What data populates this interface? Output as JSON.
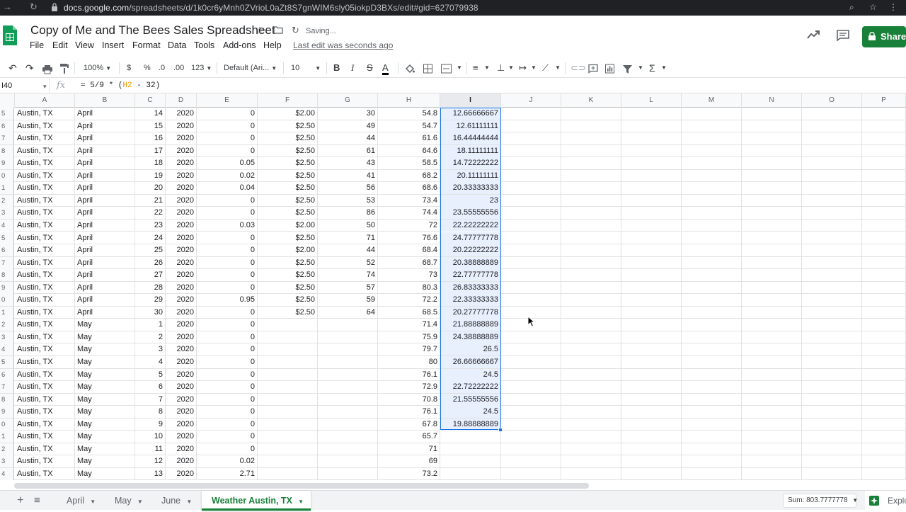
{
  "browser": {
    "url_host": "docs.google.com",
    "url_path": "/spreadsheets/d/1k0cr6yMnh0ZVrioL0aZt8S7gnWIM6sly05iokpD3BXs/edit#gid=627079938"
  },
  "header": {
    "title": "Copy of Me and The Bees Sales Spreadsheet",
    "saving_status": "Saving...",
    "menu": [
      "File",
      "Edit",
      "View",
      "Insert",
      "Format",
      "Data",
      "Tools",
      "Add-ons",
      "Help"
    ],
    "last_edit": "Last edit was seconds ago",
    "share_label": "Share"
  },
  "toolbar": {
    "zoom": "100%",
    "currency": "$",
    "percent": "%",
    "dec_decrease": ".0",
    "dec_increase": ".00",
    "more_formats": "123",
    "font": "Default (Ari...",
    "font_size": "10",
    "bold": "B",
    "italic": "I",
    "strike": "S",
    "text_color": "A",
    "functions": "Σ"
  },
  "formula_bar": {
    "cell_ref": "I40",
    "fx": "fx",
    "formula_prefix": "= 5/9 * (",
    "formula_ref": "H2",
    "formula_suffix": " - 32)"
  },
  "columns": [
    "A",
    "B",
    "C",
    "D",
    "E",
    "F",
    "G",
    "H",
    "I",
    "J",
    "K",
    "L",
    "M",
    "N",
    "O",
    "P"
  ],
  "rows": [
    {
      "n": "5",
      "a": "Austin, TX",
      "b": "April",
      "c": "14",
      "d": "2020",
      "e": "0",
      "f": "$2.00",
      "g": "30",
      "h": "54.8",
      "i": "12.66666667"
    },
    {
      "n": "6",
      "a": "Austin, TX",
      "b": "April",
      "c": "15",
      "d": "2020",
      "e": "0",
      "f": "$2.50",
      "g": "49",
      "h": "54.7",
      "i": "12.61111111"
    },
    {
      "n": "7",
      "a": "Austin, TX",
      "b": "April",
      "c": "16",
      "d": "2020",
      "e": "0",
      "f": "$2.50",
      "g": "44",
      "h": "61.6",
      "i": "16.44444444"
    },
    {
      "n": "8",
      "a": "Austin, TX",
      "b": "April",
      "c": "17",
      "d": "2020",
      "e": "0",
      "f": "$2.50",
      "g": "61",
      "h": "64.6",
      "i": "18.11111111"
    },
    {
      "n": "9",
      "a": "Austin, TX",
      "b": "April",
      "c": "18",
      "d": "2020",
      "e": "0.05",
      "f": "$2.50",
      "g": "43",
      "h": "58.5",
      "i": "14.72222222"
    },
    {
      "n": "0",
      "a": "Austin, TX",
      "b": "April",
      "c": "19",
      "d": "2020",
      "e": "0.02",
      "f": "$2.50",
      "g": "41",
      "h": "68.2",
      "i": "20.11111111"
    },
    {
      "n": "1",
      "a": "Austin, TX",
      "b": "April",
      "c": "20",
      "d": "2020",
      "e": "0.04",
      "f": "$2.50",
      "g": "56",
      "h": "68.6",
      "i": "20.33333333"
    },
    {
      "n": "2",
      "a": "Austin, TX",
      "b": "April",
      "c": "21",
      "d": "2020",
      "e": "0",
      "f": "$2.50",
      "g": "53",
      "h": "73.4",
      "i": "23"
    },
    {
      "n": "3",
      "a": "Austin, TX",
      "b": "April",
      "c": "22",
      "d": "2020",
      "e": "0",
      "f": "$2.50",
      "g": "86",
      "h": "74.4",
      "i": "23.55555556"
    },
    {
      "n": "4",
      "a": "Austin, TX",
      "b": "April",
      "c": "23",
      "d": "2020",
      "e": "0.03",
      "f": "$2.00",
      "g": "50",
      "h": "72",
      "i": "22.22222222"
    },
    {
      "n": "5",
      "a": "Austin, TX",
      "b": "April",
      "c": "24",
      "d": "2020",
      "e": "0",
      "f": "$2.50",
      "g": "71",
      "h": "76.6",
      "i": "24.77777778"
    },
    {
      "n": "6",
      "a": "Austin, TX",
      "b": "April",
      "c": "25",
      "d": "2020",
      "e": "0",
      "f": "$2.00",
      "g": "44",
      "h": "68.4",
      "i": "20.22222222"
    },
    {
      "n": "7",
      "a": "Austin, TX",
      "b": "April",
      "c": "26",
      "d": "2020",
      "e": "0",
      "f": "$2.50",
      "g": "52",
      "h": "68.7",
      "i": "20.38888889"
    },
    {
      "n": "8",
      "a": "Austin, TX",
      "b": "April",
      "c": "27",
      "d": "2020",
      "e": "0",
      "f": "$2.50",
      "g": "74",
      "h": "73",
      "i": "22.77777778"
    },
    {
      "n": "9",
      "a": "Austin, TX",
      "b": "April",
      "c": "28",
      "d": "2020",
      "e": "0",
      "f": "$2.50",
      "g": "57",
      "h": "80.3",
      "i": "26.83333333"
    },
    {
      "n": "0",
      "a": "Austin, TX",
      "b": "April",
      "c": "29",
      "d": "2020",
      "e": "0.95",
      "f": "$2.50",
      "g": "59",
      "h": "72.2",
      "i": "22.33333333"
    },
    {
      "n": "1",
      "a": "Austin, TX",
      "b": "April",
      "c": "30",
      "d": "2020",
      "e": "0",
      "f": "$2.50",
      "g": "64",
      "h": "68.5",
      "i": "20.27777778"
    },
    {
      "n": "2",
      "a": "Austin, TX",
      "b": "May",
      "c": "1",
      "d": "2020",
      "e": "0",
      "f": "",
      "g": "",
      "h": "71.4",
      "i": "21.88888889"
    },
    {
      "n": "3",
      "a": "Austin, TX",
      "b": "May",
      "c": "2",
      "d": "2020",
      "e": "0",
      "f": "",
      "g": "",
      "h": "75.9",
      "i": "24.38888889"
    },
    {
      "n": "4",
      "a": "Austin, TX",
      "b": "May",
      "c": "3",
      "d": "2020",
      "e": "0",
      "f": "",
      "g": "",
      "h": "79.7",
      "i": "26.5"
    },
    {
      "n": "5",
      "a": "Austin, TX",
      "b": "May",
      "c": "4",
      "d": "2020",
      "e": "0",
      "f": "",
      "g": "",
      "h": "80",
      "i": "26.66666667"
    },
    {
      "n": "6",
      "a": "Austin, TX",
      "b": "May",
      "c": "5",
      "d": "2020",
      "e": "0",
      "f": "",
      "g": "",
      "h": "76.1",
      "i": "24.5"
    },
    {
      "n": "7",
      "a": "Austin, TX",
      "b": "May",
      "c": "6",
      "d": "2020",
      "e": "0",
      "f": "",
      "g": "",
      "h": "72.9",
      "i": "22.72222222"
    },
    {
      "n": "8",
      "a": "Austin, TX",
      "b": "May",
      "c": "7",
      "d": "2020",
      "e": "0",
      "f": "",
      "g": "",
      "h": "70.8",
      "i": "21.55555556"
    },
    {
      "n": "9",
      "a": "Austin, TX",
      "b": "May",
      "c": "8",
      "d": "2020",
      "e": "0",
      "f": "",
      "g": "",
      "h": "76.1",
      "i": "24.5"
    },
    {
      "n": "0",
      "a": "Austin, TX",
      "b": "May",
      "c": "9",
      "d": "2020",
      "e": "0",
      "f": "",
      "g": "",
      "h": "67.8",
      "i": "19.88888889"
    },
    {
      "n": "1",
      "a": "Austin, TX",
      "b": "May",
      "c": "10",
      "d": "2020",
      "e": "0",
      "f": "",
      "g": "",
      "h": "65.7",
      "i": ""
    },
    {
      "n": "2",
      "a": "Austin, TX",
      "b": "May",
      "c": "11",
      "d": "2020",
      "e": "0",
      "f": "",
      "g": "",
      "h": "71",
      "i": ""
    },
    {
      "n": "3",
      "a": "Austin, TX",
      "b": "May",
      "c": "12",
      "d": "2020",
      "e": "0.02",
      "f": "",
      "g": "",
      "h": "69",
      "i": ""
    },
    {
      "n": "4",
      "a": "Austin, TX",
      "b": "May",
      "c": "13",
      "d": "2020",
      "e": "2.71",
      "f": "",
      "g": "",
      "h": "73.2",
      "i": ""
    }
  ],
  "tabs": [
    {
      "label": "April",
      "active": false
    },
    {
      "label": "May",
      "active": false
    },
    {
      "label": "June",
      "active": false
    },
    {
      "label": "Weather Austin, TX",
      "active": true
    }
  ],
  "status": {
    "sum": "Sum: 803.7777778",
    "explore": "Explo"
  },
  "colors": {
    "brand_green": "#188038",
    "selection_blue": "#1a73e8",
    "selection_fill": "#e8f0fe"
  }
}
